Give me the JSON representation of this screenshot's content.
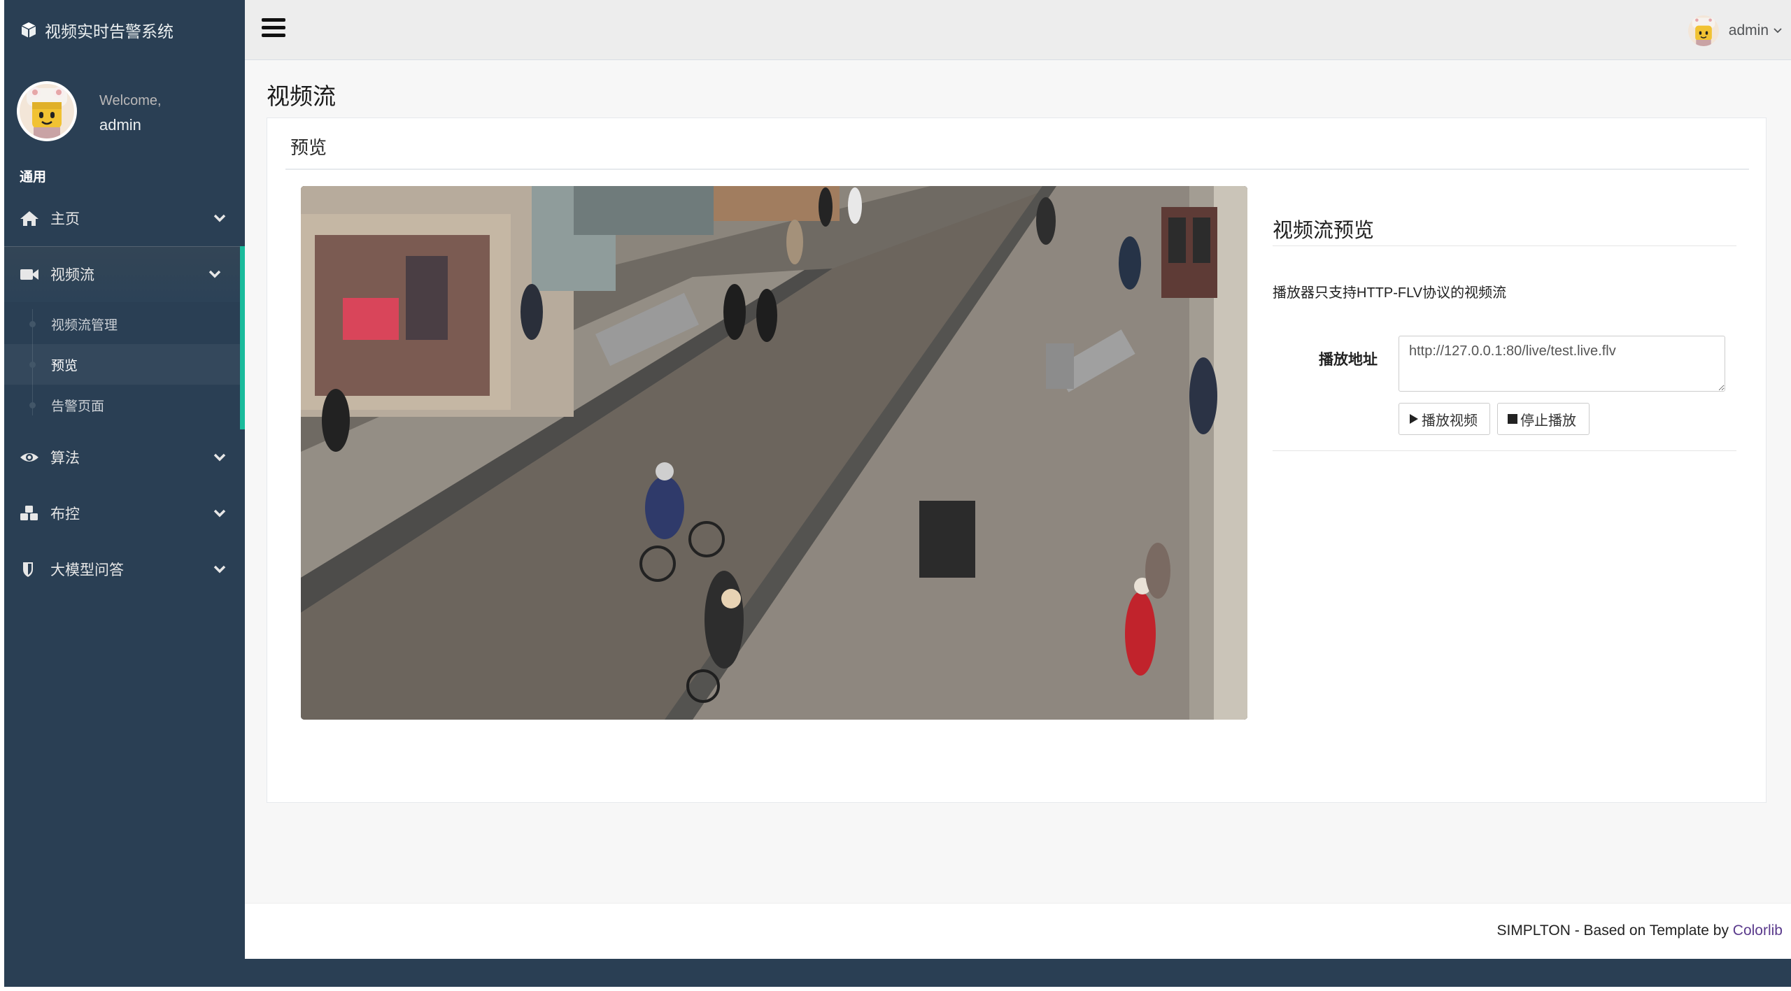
{
  "sidebar": {
    "brand": "视频实时告警系统",
    "welcome": "Welcome,",
    "username": "admin",
    "section_title": "通用",
    "menu": [
      {
        "label": "主页",
        "icon": "home-icon"
      },
      {
        "label": "视频流",
        "icon": "video-camera-icon",
        "active": true
      },
      {
        "label": "算法",
        "icon": "eye-icon"
      },
      {
        "label": "布控",
        "icon": "cubes-icon"
      },
      {
        "label": "大模型问答",
        "icon": "shield-icon"
      }
    ],
    "submenu": [
      {
        "label": "视频流管理"
      },
      {
        "label": "预览",
        "current": true
      },
      {
        "label": "告警页面"
      }
    ]
  },
  "topnav": {
    "username": "admin"
  },
  "page": {
    "title": "视频流",
    "panel_title": "预览"
  },
  "preview": {
    "title": "视频流预览",
    "note": "播放器只支持HTTP-FLV协议的视频流",
    "address_label": "播放地址",
    "address_value": "http://127.0.0.1:80/live/test.live.flv",
    "play_button": "播放视频",
    "stop_button": "停止播放"
  },
  "footer": {
    "text": "SIMPLTON - Based on Template by ",
    "link": "Colorlib"
  },
  "colors": {
    "sidebar_bg": "#2a3f54",
    "accent": "#1abb9c",
    "topnav_bg": "#ededed",
    "content_bg": "#f7f7f7",
    "link": "#5a3a8c"
  }
}
